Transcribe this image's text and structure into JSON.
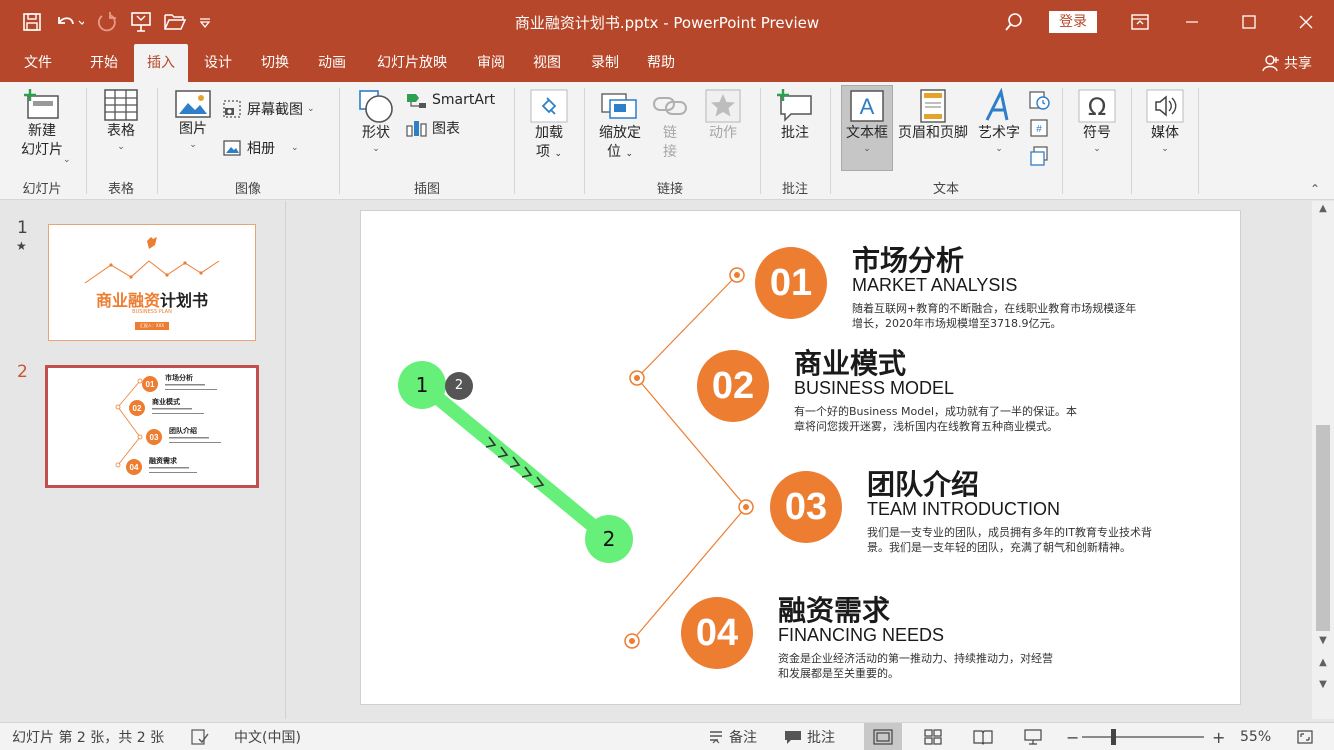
{
  "window": {
    "title": "商业融资计划书.pptx  -  PowerPoint Preview",
    "sign_in": "登录",
    "accent": "#b7472a"
  },
  "quick_access": [
    "save-icon",
    "undo-icon",
    "redo-icon",
    "present-icon",
    "open-icon",
    "customize-icon"
  ],
  "tabs": [
    "文件",
    "开始",
    "插入",
    "设计",
    "切换",
    "动画",
    "幻灯片放映",
    "审阅",
    "视图",
    "录制",
    "帮助"
  ],
  "active_tab": "插入",
  "share": "共享",
  "ribbon": {
    "new_slide": "新建",
    "new_slide2": "幻灯片",
    "group_slides": "幻灯片",
    "table": "表格",
    "group_table": "表格",
    "pictures": "图片",
    "screenshot": "屏幕截图",
    "album": "相册",
    "group_images": "图像",
    "shapes": "形状",
    "smartart": "SmartArt",
    "chart": "图表",
    "group_illustrations": "插图",
    "addins": "加载",
    "addins2": "项",
    "zoom": "缩放定",
    "zoom2": "位",
    "link": "链",
    "link2": "接",
    "action": "动作",
    "group_links": "链接",
    "comment": "批注",
    "group_comments": "批注",
    "textbox": "文本框",
    "header_footer": "页眉和页脚",
    "wordart": "艺术字",
    "group_text": "文本",
    "symbols": "符号",
    "media": "媒体"
  },
  "thumbnails": {
    "slide1_num": "1",
    "slide1_star": "★",
    "slide2_num": "2",
    "slide1_title_orange": "商业融资",
    "slide1_title_dark": "计划书",
    "slide1_sub": "BUSINESS PLAN",
    "slide1_btn": "汇报人：XXX",
    "slide2_items": [
      {
        "num": "01",
        "title": "市场分析",
        "sub": "MARKET ANALYSIS"
      },
      {
        "num": "02",
        "title": "商业模式",
        "sub": "BUSINESS MODEL"
      },
      {
        "num": "03",
        "title": "团队介绍",
        "sub": "TEAM INTRODUCTION"
      },
      {
        "num": "04",
        "title": "融资需求",
        "sub": "FINANCING NEEDS"
      }
    ]
  },
  "slide": {
    "items": [
      {
        "num": "01",
        "title": "市场分析",
        "sub": "MARKET ANALYSIS",
        "desc": "随着互联网+教育的不断融合，在线职业教育市场规模逐年增长，2020年市场规模增至3718.9亿元。"
      },
      {
        "num": "02",
        "title": "商业模式",
        "sub": "BUSINESS MODEL",
        "desc": "有一个好的Business Model，成功就有了一半的保证。本章将问您拨开迷雾，浅析国内在线教育五种商业模式。"
      },
      {
        "num": "03",
        "title": "团队介绍",
        "sub": "TEAM INTRODUCTION",
        "desc": "我们是一支专业的团队，成员拥有多年的IT教育专业技术背景。我们是一支年轻的团队，充满了朝气和创新精神。"
      },
      {
        "num": "04",
        "title": "融资需求",
        "sub": "FINANCING NEEDS",
        "desc": "资金是企业经济活动的第一推动力、持续推动力，对经营和发展都是至关重要的。"
      }
    ],
    "accent": "#ed7d31",
    "drag_start": "1",
    "drag_end": "2",
    "drag_badge": "2",
    "drag_color": "#66f07a"
  },
  "status": {
    "slide_info": "幻灯片 第 2 张，共 2 张",
    "language": "中文(中国)",
    "notes": "备注",
    "comments": "批注",
    "zoom": "55%"
  }
}
